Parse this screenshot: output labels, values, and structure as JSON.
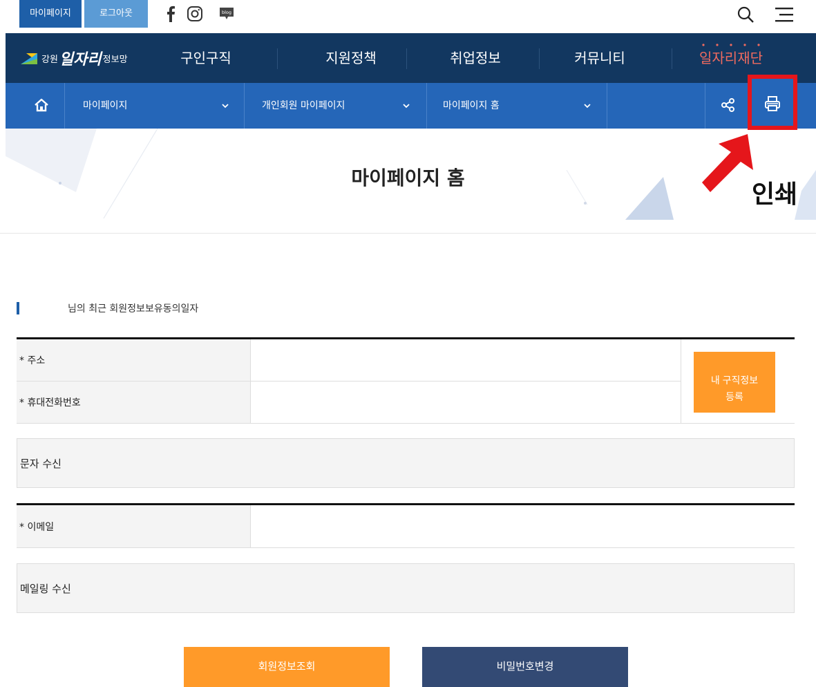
{
  "topbar": {
    "mypage_label": "마이페이지",
    "logout_label": "로그아웃",
    "blog_label": "blog"
  },
  "gnb": {
    "logo_small": "강원",
    "logo_large": "일자리",
    "logo_small2": "정보망",
    "items": [
      "구인구직",
      "지원정책",
      "취업정보",
      "커뮤니티",
      "일자리재단"
    ]
  },
  "breadcrumb": {
    "level1": "마이페이지",
    "level2": "개인회원 마이페이지",
    "level3": "마이페이지 홈"
  },
  "page_title": "마이페이지 홈",
  "annotation": {
    "label": "인쇄",
    "color": "#e5161b"
  },
  "info": {
    "heading": "님의 최근 회원정보보유동의일자"
  },
  "form": {
    "address_label": "* 주소",
    "phone_label": "* 휴대전화번호",
    "register_button": [
      "내 구직정보",
      "등록"
    ],
    "sms_label": "문자 수신",
    "email_label": "* 이메일",
    "mailing_label": "메일링 수신"
  },
  "actions": {
    "view_info": "회원정보조회",
    "change_password": "비밀번호변경"
  },
  "colors": {
    "navy": "#123760",
    "blue": "#2566b8",
    "orange": "#ff9a29",
    "button_navy": "#334a74"
  }
}
